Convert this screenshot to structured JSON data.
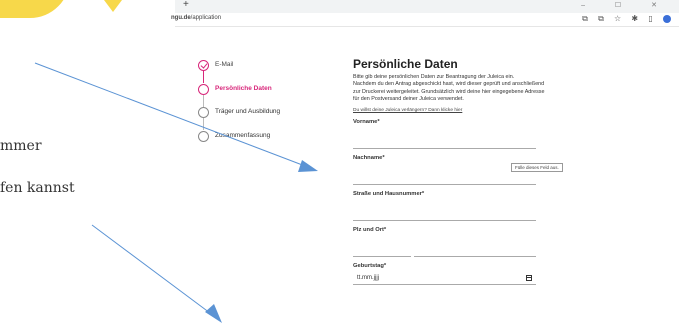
{
  "tutorial": {
    "line1": "mmer",
    "line2": "fen kannst"
  },
  "browser": {
    "new_tab": "+",
    "window_controls": "– ☐ ✕",
    "url_host": "ngu.de",
    "url_path": "/application",
    "toolbar_icons": [
      "⧉",
      "⧉",
      "☆",
      "✱",
      "▯"
    ]
  },
  "steps": [
    {
      "label": "E-Mail",
      "state": "done"
    },
    {
      "label": "Persönliche Daten",
      "state": "active"
    },
    {
      "label": "Träger und Ausbildung",
      "state": "pending"
    },
    {
      "label": "Zusammenfassung",
      "state": "pending"
    }
  ],
  "form": {
    "title": "Persönliche Daten",
    "intro_1": "Bitte gib deine persönlichen Daten zur Beantragung der Juleica ein.",
    "intro_2": "Nachdem du den Antrag abgeschickt hast, wird dieser geprüft und anschließend zur Druckerei weitergeleitet. Grundsätzlich wird deine hier eingegebene Adresse für den Postversand deiner Juleica verwendet.",
    "link": "Du willst deine Juleica verlängern? Dann klicke hier",
    "firstname_label": "Vorname*",
    "lastname_label": "Nachname*",
    "tooltip": "Fülle dieses Feld aus.",
    "street_label": "Straße und Hausnummer*",
    "city_label": "Plz und Ort*",
    "birthday_label": "Geburtstag*",
    "birthday_placeholder": "tt.mm.jjjj"
  },
  "colors": {
    "accent": "#d8267a",
    "arrow": "#5b93d4",
    "highlight": "#f7d84a"
  }
}
